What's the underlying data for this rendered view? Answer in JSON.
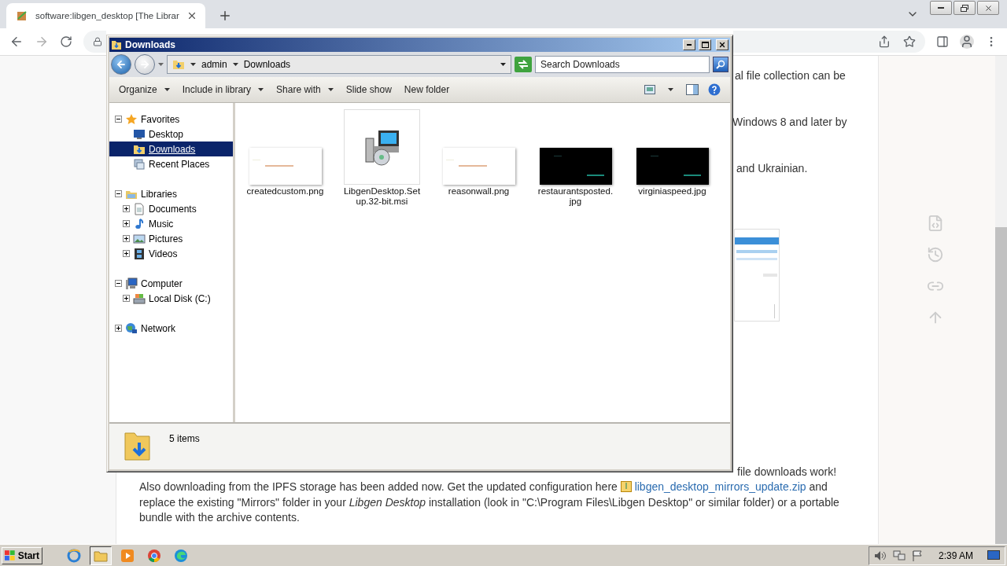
{
  "browser": {
    "tab": {
      "title": "software:libgen_desktop [The Librar",
      "selected": true
    }
  },
  "page": {
    "fragments": [
      "al file collection can be",
      "Windows 8 and later by",
      "and Ukrainian."
    ],
    "attention_tail": "file downloads work!",
    "paragraph": {
      "before": "Also downloading from the IPFS storage has been added now. Get the updated configuration here",
      "link": "libgen_desktop_mirrors_update.zip",
      "after": "and replace the existing \"Mirrors\" folder in your *Libgen Desktop* installation (look in \"C:\\Program Files\\Libgen Desktop\" or similar folder) or a portable bundle with the archive contents."
    }
  },
  "explorer": {
    "title": "Downloads",
    "breadcrumb": [
      "admin",
      "Downloads"
    ],
    "search": {
      "placeholder": "Search Downloads"
    },
    "commands": [
      {
        "label": "Organize",
        "menu": true
      },
      {
        "label": "Include in library",
        "menu": true
      },
      {
        "label": "Share with",
        "menu": true
      },
      {
        "label": "Slide show",
        "menu": false
      },
      {
        "label": "New folder",
        "menu": false
      }
    ],
    "nav": [
      {
        "label": "Favorites",
        "kind": "star",
        "expanded": true,
        "selected": false,
        "children": [
          {
            "label": "Desktop",
            "kind": "desktop",
            "selected": false
          },
          {
            "label": "Downloads",
            "kind": "downloads",
            "selected": true
          },
          {
            "label": "Recent Places",
            "kind": "recent",
            "selected": false
          }
        ]
      },
      {
        "label": "Libraries",
        "kind": "library",
        "expanded": true,
        "selected": false,
        "children": [
          {
            "label": "Documents",
            "kind": "documents",
            "expanded": false,
            "selected": false
          },
          {
            "label": "Music",
            "kind": "music",
            "expanded": false,
            "selected": false
          },
          {
            "label": "Pictures",
            "kind": "pictures",
            "expanded": false,
            "selected": false
          },
          {
            "label": "Videos",
            "kind": "videos",
            "expanded": false,
            "selected": false
          }
        ]
      },
      {
        "label": "Computer",
        "kind": "computer",
        "expanded": true,
        "selected": false,
        "children": [
          {
            "label": "Local Disk (C:)",
            "kind": "disk",
            "expanded": false,
            "selected": false
          }
        ]
      },
      {
        "label": "Network",
        "kind": "network",
        "expanded": false,
        "selected": false
      }
    ],
    "files": [
      {
        "name": "createdcustom.png",
        "kind": "light"
      },
      {
        "name": "LibgenDesktop.Set up.32-bit.msi",
        "kind": "installer"
      },
      {
        "name": "reasonwall.png",
        "kind": "light"
      },
      {
        "name": "restaurantsposted. jpg",
        "kind": "dark"
      },
      {
        "name": "virginiaspeed.jpg",
        "kind": "dark"
      }
    ],
    "status": "5 items"
  },
  "taskbar": {
    "start": "Start",
    "apps": [
      {
        "kind": "ie",
        "selected": false
      },
      {
        "kind": "explorer",
        "selected": true
      },
      {
        "kind": "media",
        "selected": false
      },
      {
        "kind": "chrome",
        "selected": false
      },
      {
        "kind": "edge",
        "selected": false
      }
    ],
    "clock": "2:39 AM"
  }
}
